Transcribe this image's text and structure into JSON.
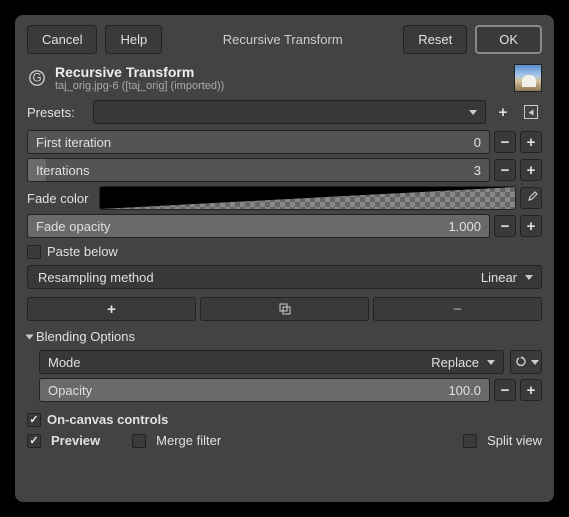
{
  "topbar": {
    "cancel": "Cancel",
    "help": "Help",
    "title": "Recursive Transform",
    "reset": "Reset",
    "ok": "OK"
  },
  "header": {
    "title": "Recursive Transform",
    "subtitle": "taj_orig.jpg-6 ([taj_orig] (imported))"
  },
  "presets": {
    "label": "Presets:"
  },
  "first_iteration": {
    "label": "First iteration",
    "value": "0"
  },
  "iterations": {
    "label": "Iterations",
    "value": "3"
  },
  "fade_color": {
    "label": "Fade color"
  },
  "fade_opacity": {
    "label": "Fade opacity",
    "value": "1.000"
  },
  "paste_below": {
    "label": "Paste below"
  },
  "resampling": {
    "label": "Resampling method",
    "value": "Linear"
  },
  "blending": {
    "title": "Blending Options",
    "mode_label": "Mode",
    "mode_value": "Replace",
    "opacity_label": "Opacity",
    "opacity_value": "100.0"
  },
  "on_canvas": {
    "label": "On-canvas controls"
  },
  "preview": {
    "label": "Preview"
  },
  "merge": {
    "label": "Merge filter"
  },
  "split": {
    "label": "Split view"
  }
}
